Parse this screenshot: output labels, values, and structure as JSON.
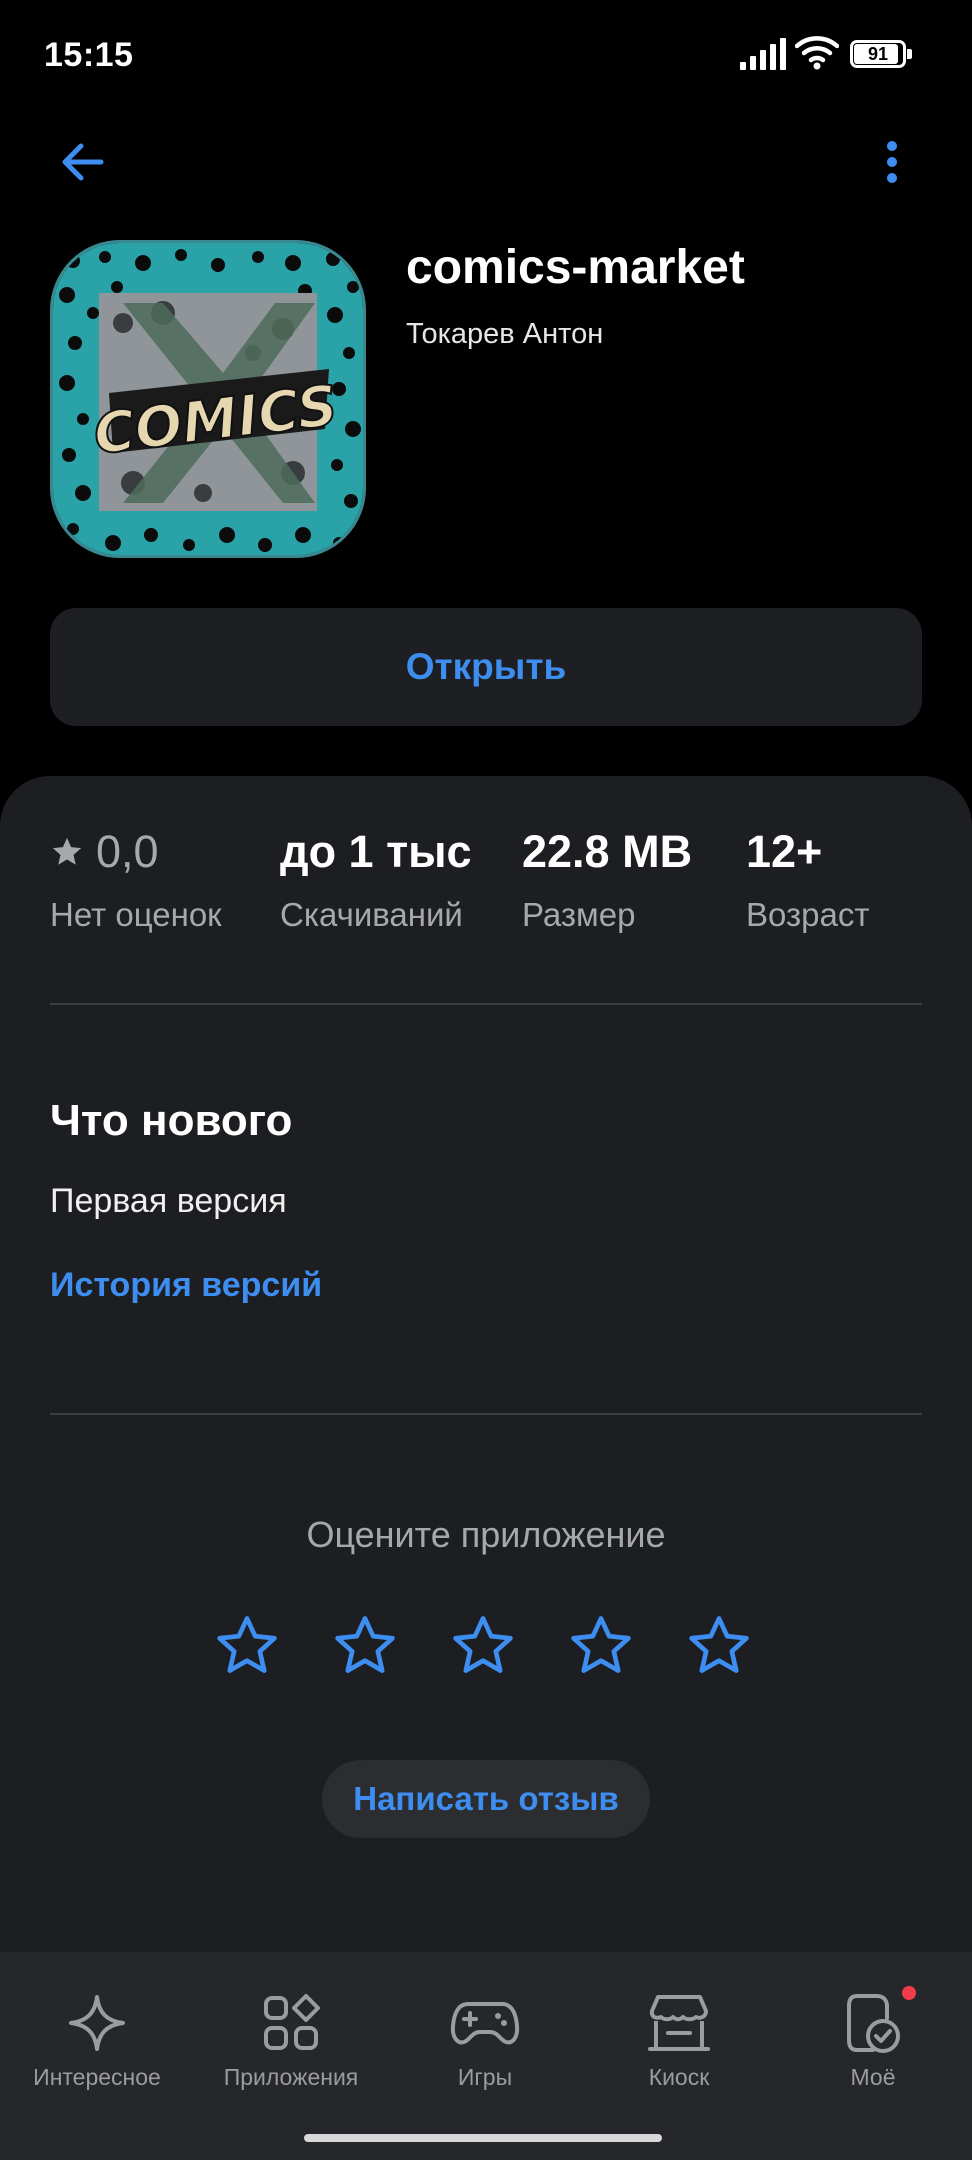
{
  "status_bar": {
    "time": "15:15",
    "battery": "91",
    "battery_level": 0.91
  },
  "app": {
    "title": "comics-market",
    "developer": "Токарев Антон",
    "icon_text": "COMICS",
    "open_label": "Открыть"
  },
  "stats": [
    {
      "value": "0,0",
      "label": "Нет оценок",
      "icon": "star-icon"
    },
    {
      "value": "до 1 тыс",
      "label": "Скачиваний"
    },
    {
      "value": "22.8 MB",
      "label": "Размер"
    },
    {
      "value": "12+",
      "label": "Возраст"
    }
  ],
  "whats_new": {
    "title": "Что нового",
    "text": "Первая версия",
    "history_link": "История версий"
  },
  "rating": {
    "title": "Оцените приложение",
    "stars": 5,
    "review_button": "Написать отзыв"
  },
  "bottom_nav": [
    {
      "label": "Интересное",
      "icon": "sparkle-icon"
    },
    {
      "label": "Приложения",
      "icon": "apps-grid-icon"
    },
    {
      "label": "Игры",
      "icon": "gamepad-icon"
    },
    {
      "label": "Киоск",
      "icon": "kiosk-icon"
    },
    {
      "label": "Моё",
      "icon": "my-apps-icon",
      "badge": true
    }
  ],
  "colors": {
    "accent": "#3d8ef0",
    "card": "#1d1e21",
    "nav": "#26272b",
    "badge": "#ef3e4a"
  }
}
